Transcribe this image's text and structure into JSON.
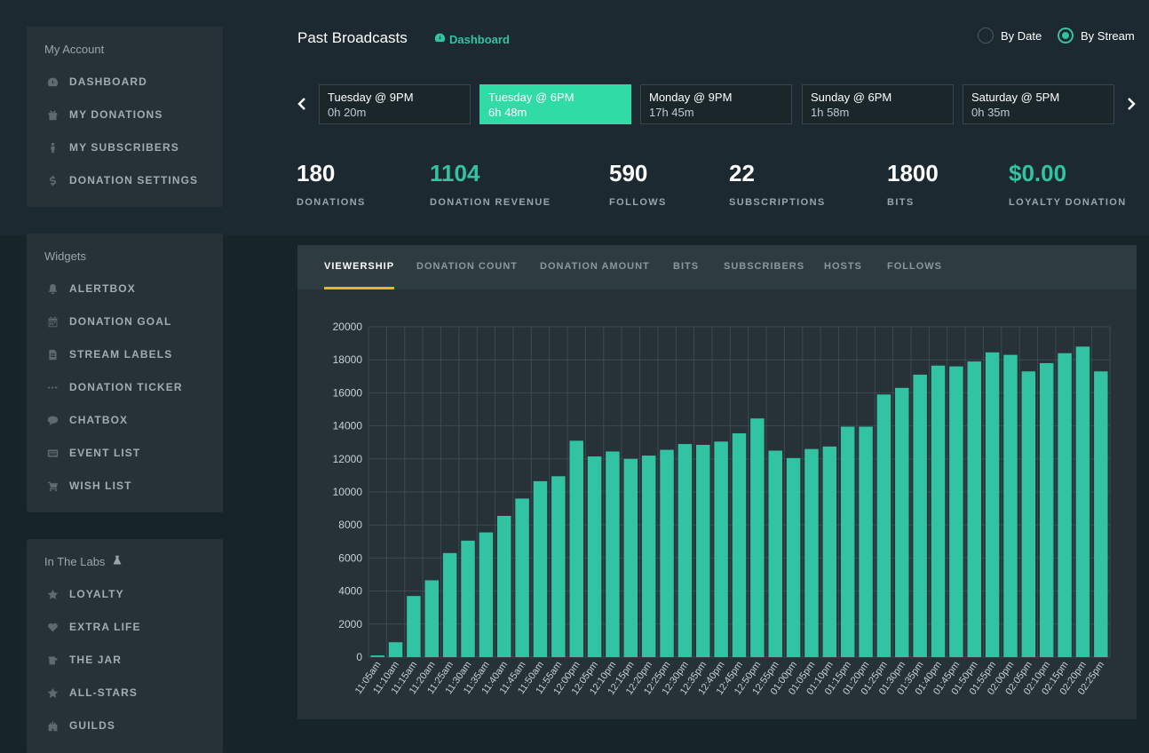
{
  "sidebar": {
    "account": {
      "title": "My Account",
      "items": [
        {
          "label": "DASHBOARD",
          "icon": "dashboard-icon"
        },
        {
          "label": "MY DONATIONS",
          "icon": "gift-icon"
        },
        {
          "label": "MY SUBSCRIBERS",
          "icon": "person-icon"
        },
        {
          "label": "DONATION SETTINGS",
          "icon": "dollar-icon"
        }
      ]
    },
    "widgets": {
      "title": "Widgets",
      "items": [
        {
          "label": "ALERTBOX",
          "icon": "bell-icon"
        },
        {
          "label": "DONATION GOAL",
          "icon": "calendar-icon"
        },
        {
          "label": "STREAM LABELS",
          "icon": "document-icon"
        },
        {
          "label": "DONATION TICKER",
          "icon": "ellipsis-icon"
        },
        {
          "label": "CHATBOX",
          "icon": "chat-icon"
        },
        {
          "label": "EVENT LIST",
          "icon": "list-icon"
        },
        {
          "label": "WISH LIST",
          "icon": "cart-icon"
        }
      ]
    },
    "labs": {
      "title": "In The Labs",
      "items": [
        {
          "label": "LOYALTY",
          "icon": "star-icon"
        },
        {
          "label": "EXTRA LIFE",
          "icon": "heart-icon"
        },
        {
          "label": "THE JAR",
          "icon": "jar-icon"
        },
        {
          "label": "ALL-STARS",
          "icon": "star-icon"
        },
        {
          "label": "GUILDS",
          "icon": "castle-icon"
        }
      ]
    }
  },
  "header": {
    "title": "Past Broadcasts",
    "dashboard_link": "Dashboard",
    "radio_by_date": "By Date",
    "radio_by_stream": "By Stream",
    "selected_mode": "By Stream"
  },
  "broadcasts": [
    {
      "title": "Tuesday @ 9PM",
      "duration": "0h 20m"
    },
    {
      "title": "Tuesday @ 6PM",
      "duration": "6h 48m",
      "active": true
    },
    {
      "title": "Monday @ 9PM",
      "duration": "17h 45m"
    },
    {
      "title": "Sunday @ 6PM",
      "duration": "1h 58m"
    },
    {
      "title": "Saturday @ 5PM",
      "duration": "0h 35m"
    }
  ],
  "stats": [
    {
      "value": "180",
      "label": "DONATIONS"
    },
    {
      "value": "1104",
      "label": "DONATION REVENUE"
    },
    {
      "value": "590",
      "label": "FOLLOWS"
    },
    {
      "value": "22",
      "label": "SUBSCRIPTIONS"
    },
    {
      "value": "1800",
      "label": "BITS"
    },
    {
      "value": "$0.00",
      "label": "LOYALTY DONATION"
    }
  ],
  "tabs": [
    "VIEWERSHIP",
    "DONATION COUNT",
    "DONATION AMOUNT",
    "BITS",
    "SUBSCRIBERS",
    "HOSTS",
    "FOLLOWS"
  ],
  "active_tab": "VIEWERSHIP",
  "colors": {
    "accent": "#31c3a2",
    "bar": "#31c3a2",
    "tab_underline": "#f0b41a",
    "active_card": "#31dba5"
  },
  "chart_data": {
    "type": "bar",
    "categories": [
      "11:05am",
      "11:10am",
      "11:15am",
      "11:20am",
      "11:25am",
      "11:30am",
      "11:35am",
      "11:40am",
      "11:45am",
      "11:50am",
      "11:55am",
      "12:00pm",
      "12:05pm",
      "12:10pm",
      "12:15pm",
      "12:20pm",
      "12:25pm",
      "12:30pm",
      "12:35pm",
      "12:40pm",
      "12:45pm",
      "12:50pm",
      "12:55pm",
      "01:00pm",
      "01:05pm",
      "01:10pm",
      "01:15pm",
      "01:20pm",
      "01:25pm",
      "01:30pm",
      "01:35pm",
      "01:40pm",
      "01:45pm",
      "01:50pm",
      "01:55pm",
      "02:00pm",
      "02:05pm",
      "02:10pm",
      "02:15pm",
      "02:20pm",
      "02:25pm"
    ],
    "values": [
      100,
      900,
      3700,
      4650,
      6300,
      7050,
      7550,
      8550,
      9600,
      10650,
      10950,
      13100,
      12150,
      12450,
      12000,
      12200,
      12550,
      12900,
      12850,
      13050,
      13550,
      14450,
      12500,
      12050,
      12600,
      12750,
      13950,
      13950,
      15900,
      16300,
      17100,
      17650,
      17600,
      17900,
      18450,
      18300,
      17300,
      17800,
      18400,
      18800,
      17300
    ],
    "yticks": [
      "0",
      "2000",
      "4000",
      "6000",
      "8000",
      "10000",
      "12000",
      "14000",
      "16000",
      "18000",
      "20000"
    ],
    "ylim": [
      0,
      20000
    ],
    "grid": true
  }
}
